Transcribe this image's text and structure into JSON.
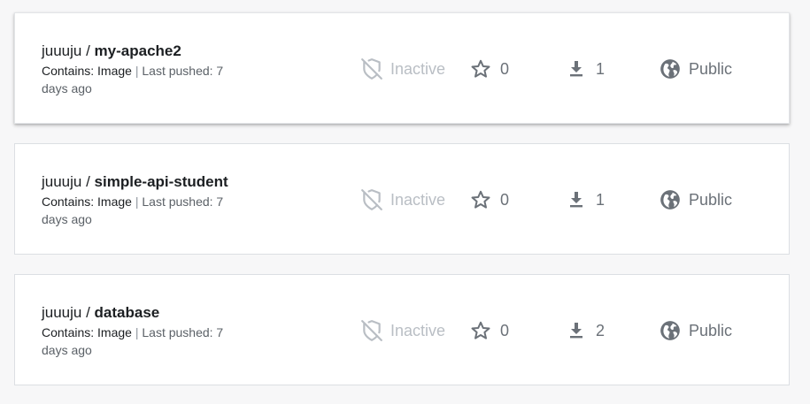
{
  "repositories": [
    {
      "namespace": "juuuju",
      "separator": " / ",
      "name": "my-apache2",
      "contains_label": "Contains: Image",
      "divider": " | ",
      "last_pushed": "Last pushed: 7 days ago",
      "status": "Inactive",
      "stars": "0",
      "pulls": "1",
      "visibility": "Public"
    },
    {
      "namespace": "juuuju",
      "separator": " / ",
      "name": "simple-api-student",
      "contains_label": "Contains: Image",
      "divider": " | ",
      "last_pushed": "Last pushed: 7 days ago",
      "status": "Inactive",
      "stars": "0",
      "pulls": "1",
      "visibility": "Public"
    },
    {
      "namespace": "juuuju",
      "separator": " / ",
      "name": "database",
      "contains_label": "Contains: Image",
      "divider": " | ",
      "last_pushed": "Last pushed: 7 days ago",
      "status": "Inactive",
      "stars": "0",
      "pulls": "2",
      "visibility": "Public"
    }
  ],
  "icons": {
    "status": "shield-off-icon",
    "stars": "star-outline-icon",
    "pulls": "download-icon",
    "visibility": "globe-icon"
  },
  "colors": {
    "inactive": "#b9bec4",
    "stat_text": "#6b7178",
    "card_border": "#dcdfe3"
  }
}
